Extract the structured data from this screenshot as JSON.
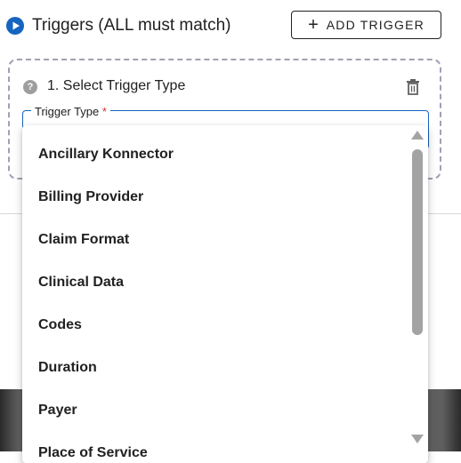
{
  "header": {
    "title": "Triggers (ALL must match)",
    "add_button": {
      "icon": "plus-icon",
      "label": "ADD TRIGGER"
    },
    "play_icon": "play-circle-icon",
    "accent_color": "#1565c0"
  },
  "trigger_card": {
    "title": "1. Select Trigger Type",
    "help_icon_glyph": "?",
    "delete_icon": "trash-icon",
    "field": {
      "label": "Trigger Type",
      "required_mark": "*"
    }
  },
  "dropdown": {
    "options": [
      "Ancillary Konnector",
      "Billing Provider",
      "Claim Format",
      "Clinical Data",
      "Codes",
      "Duration",
      "Payer",
      "Place of Service"
    ]
  }
}
